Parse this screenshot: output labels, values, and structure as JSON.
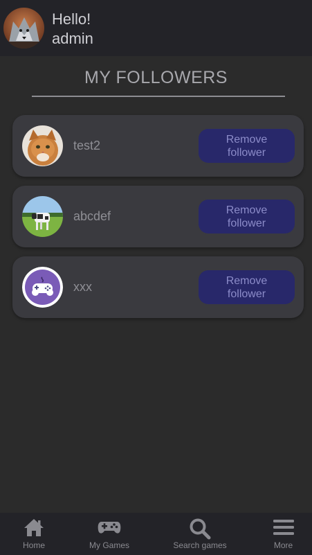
{
  "header": {
    "greeting": "Hello!",
    "username": "admin",
    "avatar_icon": "wolf-avatar"
  },
  "page": {
    "title": "MY FOLLOWERS"
  },
  "followers": [
    {
      "name": "test2",
      "avatar_icon": "cat-photo",
      "action_label": "Remove follower"
    },
    {
      "name": "abcdef",
      "avatar_icon": "cow-photo",
      "action_label": "Remove follower"
    },
    {
      "name": "xxx",
      "avatar_icon": "gamepad-avatar",
      "action_label": "Remove follower"
    }
  ],
  "nav": {
    "items": [
      {
        "label": "Home",
        "icon": "home-icon"
      },
      {
        "label": "My Games",
        "icon": "gamepad-icon"
      },
      {
        "label": "Search games",
        "icon": "search-icon"
      },
      {
        "label": "More",
        "icon": "menu-icon"
      }
    ]
  },
  "colors": {
    "background": "#2b2b2b",
    "bar": "#232328",
    "card": "#3a3a3f",
    "button": "#28286a",
    "button_text": "#8c8cc9"
  }
}
